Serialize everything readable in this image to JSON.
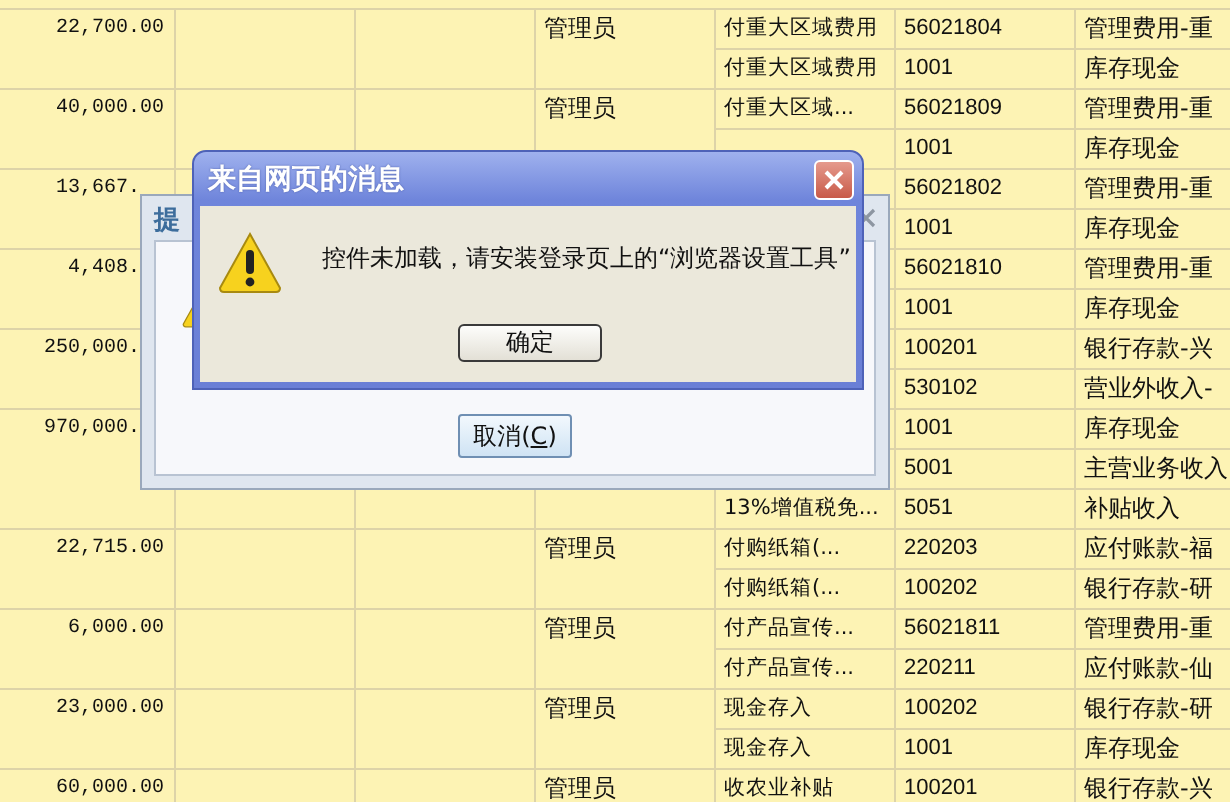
{
  "table": {
    "groups": [
      {
        "amount": "22,700.00",
        "operator": "管理员",
        "entries": [
          {
            "summary": "付重大区域费用",
            "code": "56021804",
            "account": "管理费用-重"
          },
          {
            "summary": "付重大区域费用",
            "code": "1001",
            "account": "库存现金"
          }
        ]
      },
      {
        "amount": "40,000.00",
        "operator": "管理员",
        "entries": [
          {
            "summary": "付重大区域...",
            "code": "56021809",
            "account": "管理费用-重"
          },
          {
            "code": "1001",
            "account": "库存现金"
          }
        ]
      },
      {
        "amount": "13,667.",
        "entries": [
          {
            "code": "56021802",
            "account": "管理费用-重"
          },
          {
            "code": "1001",
            "account": "库存现金"
          }
        ]
      },
      {
        "amount": "4,408.",
        "entries": [
          {
            "code": "56021810",
            "account": "管理费用-重"
          },
          {
            "code": "1001",
            "account": "库存现金"
          }
        ]
      },
      {
        "amount": "250,000.",
        "entries": [
          {
            "code": "100201",
            "account": "银行存款-兴"
          },
          {
            "code": "530102",
            "account": "营业外收入-"
          }
        ]
      },
      {
        "amount": "970,000.",
        "entries": [
          {
            "code": "1001",
            "account": "库存现金"
          },
          {
            "code": "5001",
            "account": "主营业务收入"
          },
          {
            "summary": "13%增值税免...",
            "code": "5051",
            "account": "补贴收入"
          }
        ]
      },
      {
        "amount": "22,715.00",
        "operator": "管理员",
        "entries": [
          {
            "summary": "付购纸箱(...",
            "code": "220203",
            "account": "应付账款-福"
          },
          {
            "summary": "付购纸箱(...",
            "code": "100202",
            "account": "银行存款-研"
          }
        ]
      },
      {
        "amount": "6,000.00",
        "operator": "管理员",
        "entries": [
          {
            "summary": "付产品宣传...",
            "code": "56021811",
            "account": "管理费用-重"
          },
          {
            "summary": "付产品宣传...",
            "code": "220211",
            "account": "应付账款-仙"
          }
        ]
      },
      {
        "amount": "23,000.00",
        "operator": "管理员",
        "entries": [
          {
            "summary": "现金存入",
            "code": "100202",
            "account": "银行存款-研"
          },
          {
            "summary": "现金存入",
            "code": "1001",
            "account": "库存现金"
          }
        ]
      },
      {
        "amount": "60,000.00",
        "operator": "管理员",
        "entries": [
          {
            "summary": "收农业补贴",
            "code": "100201",
            "account": "银行存款-兴"
          }
        ]
      }
    ]
  },
  "back_dialog": {
    "title": "提",
    "cancel_button": {
      "label": "取消(",
      "mnemonic": "C",
      "label_after": ")"
    }
  },
  "front_dialog": {
    "title": "来自网页的消息",
    "message": "控件未加载，请安装登录页上的“浏览器设置工具”",
    "ok_button": "确定"
  }
}
